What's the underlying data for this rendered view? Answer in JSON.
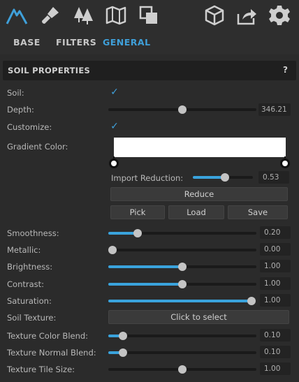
{
  "toolbar": {
    "icons": [
      "mountain-icon",
      "brush-icon",
      "trees-icon",
      "map-icon",
      "layers-icon",
      "cube-icon",
      "export-icon",
      "gear-icon"
    ],
    "accent_color": "#3fa0da"
  },
  "tabs": [
    {
      "label": "BASE",
      "active": false
    },
    {
      "label": "FILTERS",
      "active": false
    },
    {
      "label": "GENERAL",
      "active": true
    }
  ],
  "section": {
    "title": "SOIL PROPERTIES",
    "help": "?"
  },
  "soil": {
    "label": "Soil:",
    "checked": true,
    "checkmark": "✓"
  },
  "depth": {
    "label": "Depth:",
    "value": "346.21",
    "fraction": 0.5
  },
  "customize": {
    "label": "Customize:",
    "checked": true,
    "checkmark": "✓"
  },
  "gradient": {
    "label": "Gradient Color:",
    "color": "#ffffff"
  },
  "import_reduction": {
    "label": "Import Reduction:",
    "value": "0.53",
    "fraction": 0.53
  },
  "buttons": {
    "reduce": "Reduce",
    "pick": "Pick",
    "load": "Load",
    "save": "Save"
  },
  "smoothness": {
    "label": "Smoothness:",
    "value": "0.20",
    "fraction": 0.2
  },
  "metallic": {
    "label": "Metallic:",
    "value": "0.00",
    "fraction": 0.0
  },
  "brightness": {
    "label": "Brightness:",
    "value": "1.00",
    "fraction": 0.5
  },
  "contrast": {
    "label": "Contrast:",
    "value": "1.00",
    "fraction": 0.5
  },
  "saturation": {
    "label": "Saturation:",
    "value": "1.00",
    "fraction": 1.0
  },
  "soil_texture": {
    "label": "Soil Texture:",
    "button": "Click to select"
  },
  "texture_color_blend": {
    "label": "Texture Color Blend:",
    "value": "0.10",
    "fraction": 0.1
  },
  "texture_normal_blend": {
    "label": "Texture Normal Blend:",
    "value": "0.10",
    "fraction": 0.1
  },
  "texture_tile_size": {
    "label": "Texture Tile Size:",
    "value": "1.00",
    "fraction": 0.5,
    "filled": false
  }
}
